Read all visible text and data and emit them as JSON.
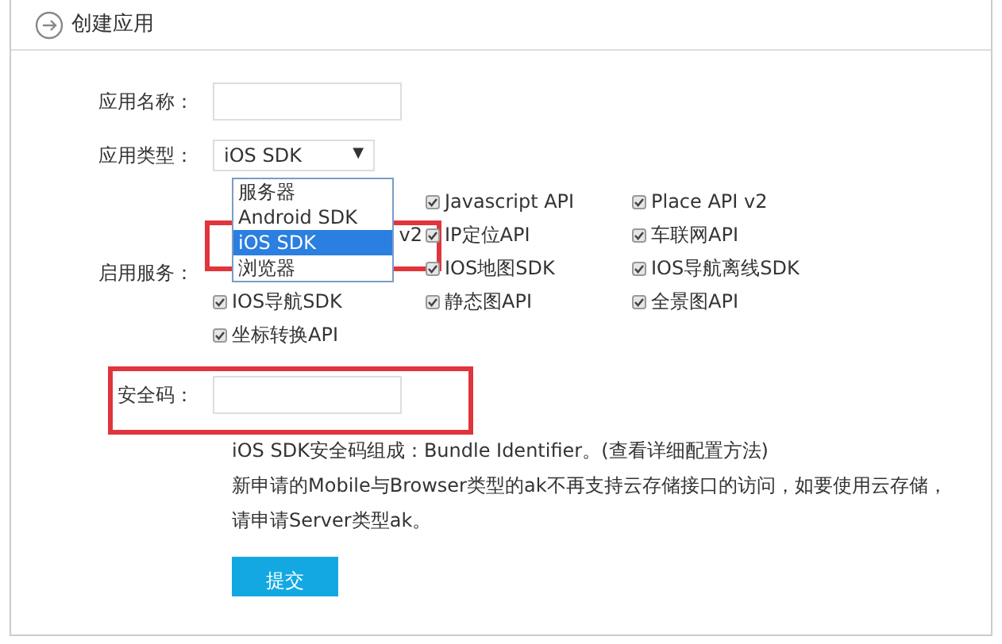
{
  "header": {
    "title": "创建应用"
  },
  "form": {
    "name": {
      "label": "应用名称："
    },
    "type": {
      "label": "应用类型：",
      "value": "iOS SDK",
      "caret": "▼",
      "expanded": true,
      "options": [
        {
          "label": "服务器",
          "selected": false
        },
        {
          "label": "Android SDK",
          "selected": false
        },
        {
          "label": "iOS SDK",
          "selected": true
        },
        {
          "label": "浏览器",
          "selected": false
        }
      ]
    },
    "services": {
      "label": "启用服务：",
      "items": [
        {
          "kind": "blank"
        },
        {
          "kind": "checkbox",
          "label": "Javascript API",
          "checked": true
        },
        {
          "kind": "checkbox",
          "label": "Place API v2",
          "checked": true
        },
        {
          "kind": "covered",
          "label": "v2"
        },
        {
          "kind": "checkbox",
          "label": "IP定位API",
          "checked": true
        },
        {
          "kind": "checkbox",
          "label": "车联网API",
          "checked": true
        },
        {
          "kind": "blank"
        },
        {
          "kind": "checkbox",
          "label": "IOS地图SDK",
          "checked": true
        },
        {
          "kind": "checkbox",
          "label": "IOS导航离线SDK",
          "checked": true
        },
        {
          "kind": "checkbox",
          "label": "IOS导航SDK",
          "checked": true
        },
        {
          "kind": "checkbox",
          "label": "静态图API",
          "checked": true
        },
        {
          "kind": "checkbox",
          "label": "全景图API",
          "checked": true
        },
        {
          "kind": "checkbox",
          "label": "坐标转换API",
          "checked": true
        }
      ]
    },
    "security": {
      "label": "安全码："
    },
    "help": [
      {
        "text": "iOS SDK安全码组成：Bundle Identifier。",
        "link": "(查看详细配置方法)"
      },
      {
        "text": "新申请的Mobile与Browser类型的ak不再支持云存储接口的访问，如要使用云存储，"
      },
      {
        "text": "请申请Server类型ak。"
      }
    ],
    "submit": "提交"
  },
  "highlights": [
    {
      "kind": "outline"
    },
    {
      "kind": "outline"
    }
  ]
}
